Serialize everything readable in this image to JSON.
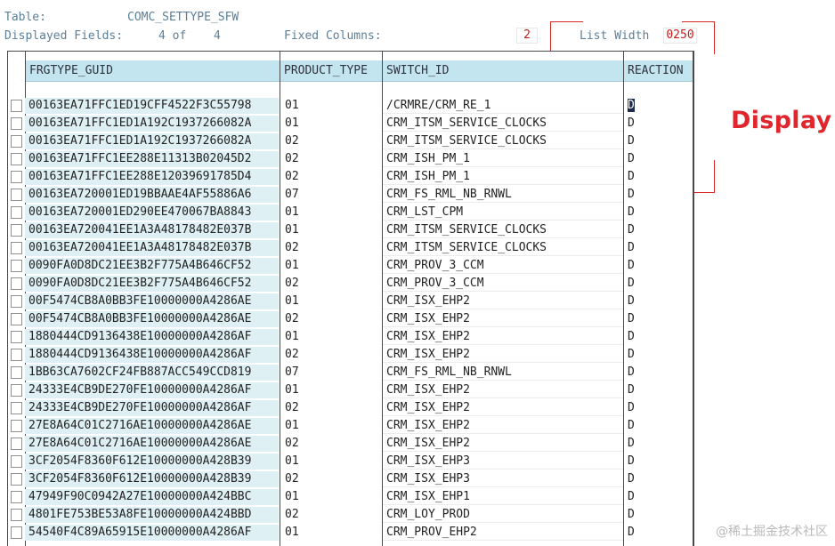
{
  "header": {
    "table_label": "Table:",
    "table_value": "COMC_SETTYPE_SFW",
    "displayed_label": "Displayed Fields:",
    "displayed_value": "4 of",
    "displayed_total": "4",
    "fixed_label": "Fixed Columns:",
    "fixed_value": "2",
    "list_width_label": "List Width",
    "list_width_value": "0250"
  },
  "annotation": {
    "text": "Display",
    "color": "#e0262c"
  },
  "columns": [
    "FRGTYPE_GUID",
    "PRODUCT_TYPE",
    "SWITCH_ID",
    "REACTION"
  ],
  "rows": [
    {
      "guid": "00163EA71FFC1ED19CFF4522F3C55798",
      "type": "01",
      "switch": "/CRMRE/CRM_RE_1",
      "reaction": "D"
    },
    {
      "guid": "00163EA71FFC1ED1A192C1937266082A",
      "type": "01",
      "switch": "CRM_ITSM_SERVICE_CLOCKS",
      "reaction": "D"
    },
    {
      "guid": "00163EA71FFC1ED1A192C1937266082A",
      "type": "02",
      "switch": "CRM_ITSM_SERVICE_CLOCKS",
      "reaction": "D"
    },
    {
      "guid": "00163EA71FFC1EE288E11313B02045D2",
      "type": "02",
      "switch": "CRM_ISH_PM_1",
      "reaction": "D"
    },
    {
      "guid": "00163EA71FFC1EE288E12039691785D4",
      "type": "02",
      "switch": "CRM_ISH_PM_1",
      "reaction": "D"
    },
    {
      "guid": "00163EA720001ED19BBAAE4AF55886A6",
      "type": "07",
      "switch": "CRM_FS_RML_NB_RNWL",
      "reaction": "D"
    },
    {
      "guid": "00163EA720001ED290EE470067BA8843",
      "type": "01",
      "switch": "CRM_LST_CPM",
      "reaction": "D"
    },
    {
      "guid": "00163EA720041EE1A3A48178482E037B",
      "type": "01",
      "switch": "CRM_ITSM_SERVICE_CLOCKS",
      "reaction": "D"
    },
    {
      "guid": "00163EA720041EE1A3A48178482E037B",
      "type": "02",
      "switch": "CRM_ITSM_SERVICE_CLOCKS",
      "reaction": "D"
    },
    {
      "guid": "0090FA0D8DC21EE3B2F775A4B646CF52",
      "type": "01",
      "switch": "CRM_PROV_3_CCM",
      "reaction": "D"
    },
    {
      "guid": "0090FA0D8DC21EE3B2F775A4B646CF52",
      "type": "02",
      "switch": "CRM_PROV_3_CCM",
      "reaction": "D"
    },
    {
      "guid": "00F5474CB8A0BB3FE10000000A4286AE",
      "type": "01",
      "switch": "CRM_ISX_EHP2",
      "reaction": "D"
    },
    {
      "guid": "00F5474CB8A0BB3FE10000000A4286AE",
      "type": "02",
      "switch": "CRM_ISX_EHP2",
      "reaction": "D"
    },
    {
      "guid": "1880444CD9136438E10000000A4286AF",
      "type": "01",
      "switch": "CRM_ISX_EHP2",
      "reaction": "D"
    },
    {
      "guid": "1880444CD9136438E10000000A4286AF",
      "type": "02",
      "switch": "CRM_ISX_EHP2",
      "reaction": "D"
    },
    {
      "guid": "1BB63CA7602CF24FB887ACC549CCD819",
      "type": "07",
      "switch": "CRM_FS_RML_NB_RNWL",
      "reaction": "D"
    },
    {
      "guid": "24333E4CB9DE270FE10000000A4286AF",
      "type": "01",
      "switch": "CRM_ISX_EHP2",
      "reaction": "D"
    },
    {
      "guid": "24333E4CB9DE270FE10000000A4286AF",
      "type": "02",
      "switch": "CRM_ISX_EHP2",
      "reaction": "D"
    },
    {
      "guid": "27E8A64C01C2716AE10000000A4286AE",
      "type": "01",
      "switch": "CRM_ISX_EHP2",
      "reaction": "D"
    },
    {
      "guid": "27E8A64C01C2716AE10000000A4286AE",
      "type": "02",
      "switch": "CRM_ISX_EHP2",
      "reaction": "D"
    },
    {
      "guid": "3CF2054F8360F612E10000000A428B39",
      "type": "01",
      "switch": "CRM_ISX_EHP3",
      "reaction": "D"
    },
    {
      "guid": "3CF2054F8360F612E10000000A428B39",
      "type": "02",
      "switch": "CRM_ISX_EHP3",
      "reaction": "D"
    },
    {
      "guid": "47949F90C0942A27E10000000A424BBC",
      "type": "01",
      "switch": "CRM_ISX_EHP1",
      "reaction": "D"
    },
    {
      "guid": "4801FE753BE53A8FE10000000A424BBD",
      "type": "02",
      "switch": "CRM_LOY_PROD",
      "reaction": "D"
    },
    {
      "guid": "54540F4C89A65915E10000000A4286AF",
      "type": "01",
      "switch": "CRM_PROV_EHP2",
      "reaction": "D"
    }
  ],
  "watermark": "@稀土掘金技术社区"
}
